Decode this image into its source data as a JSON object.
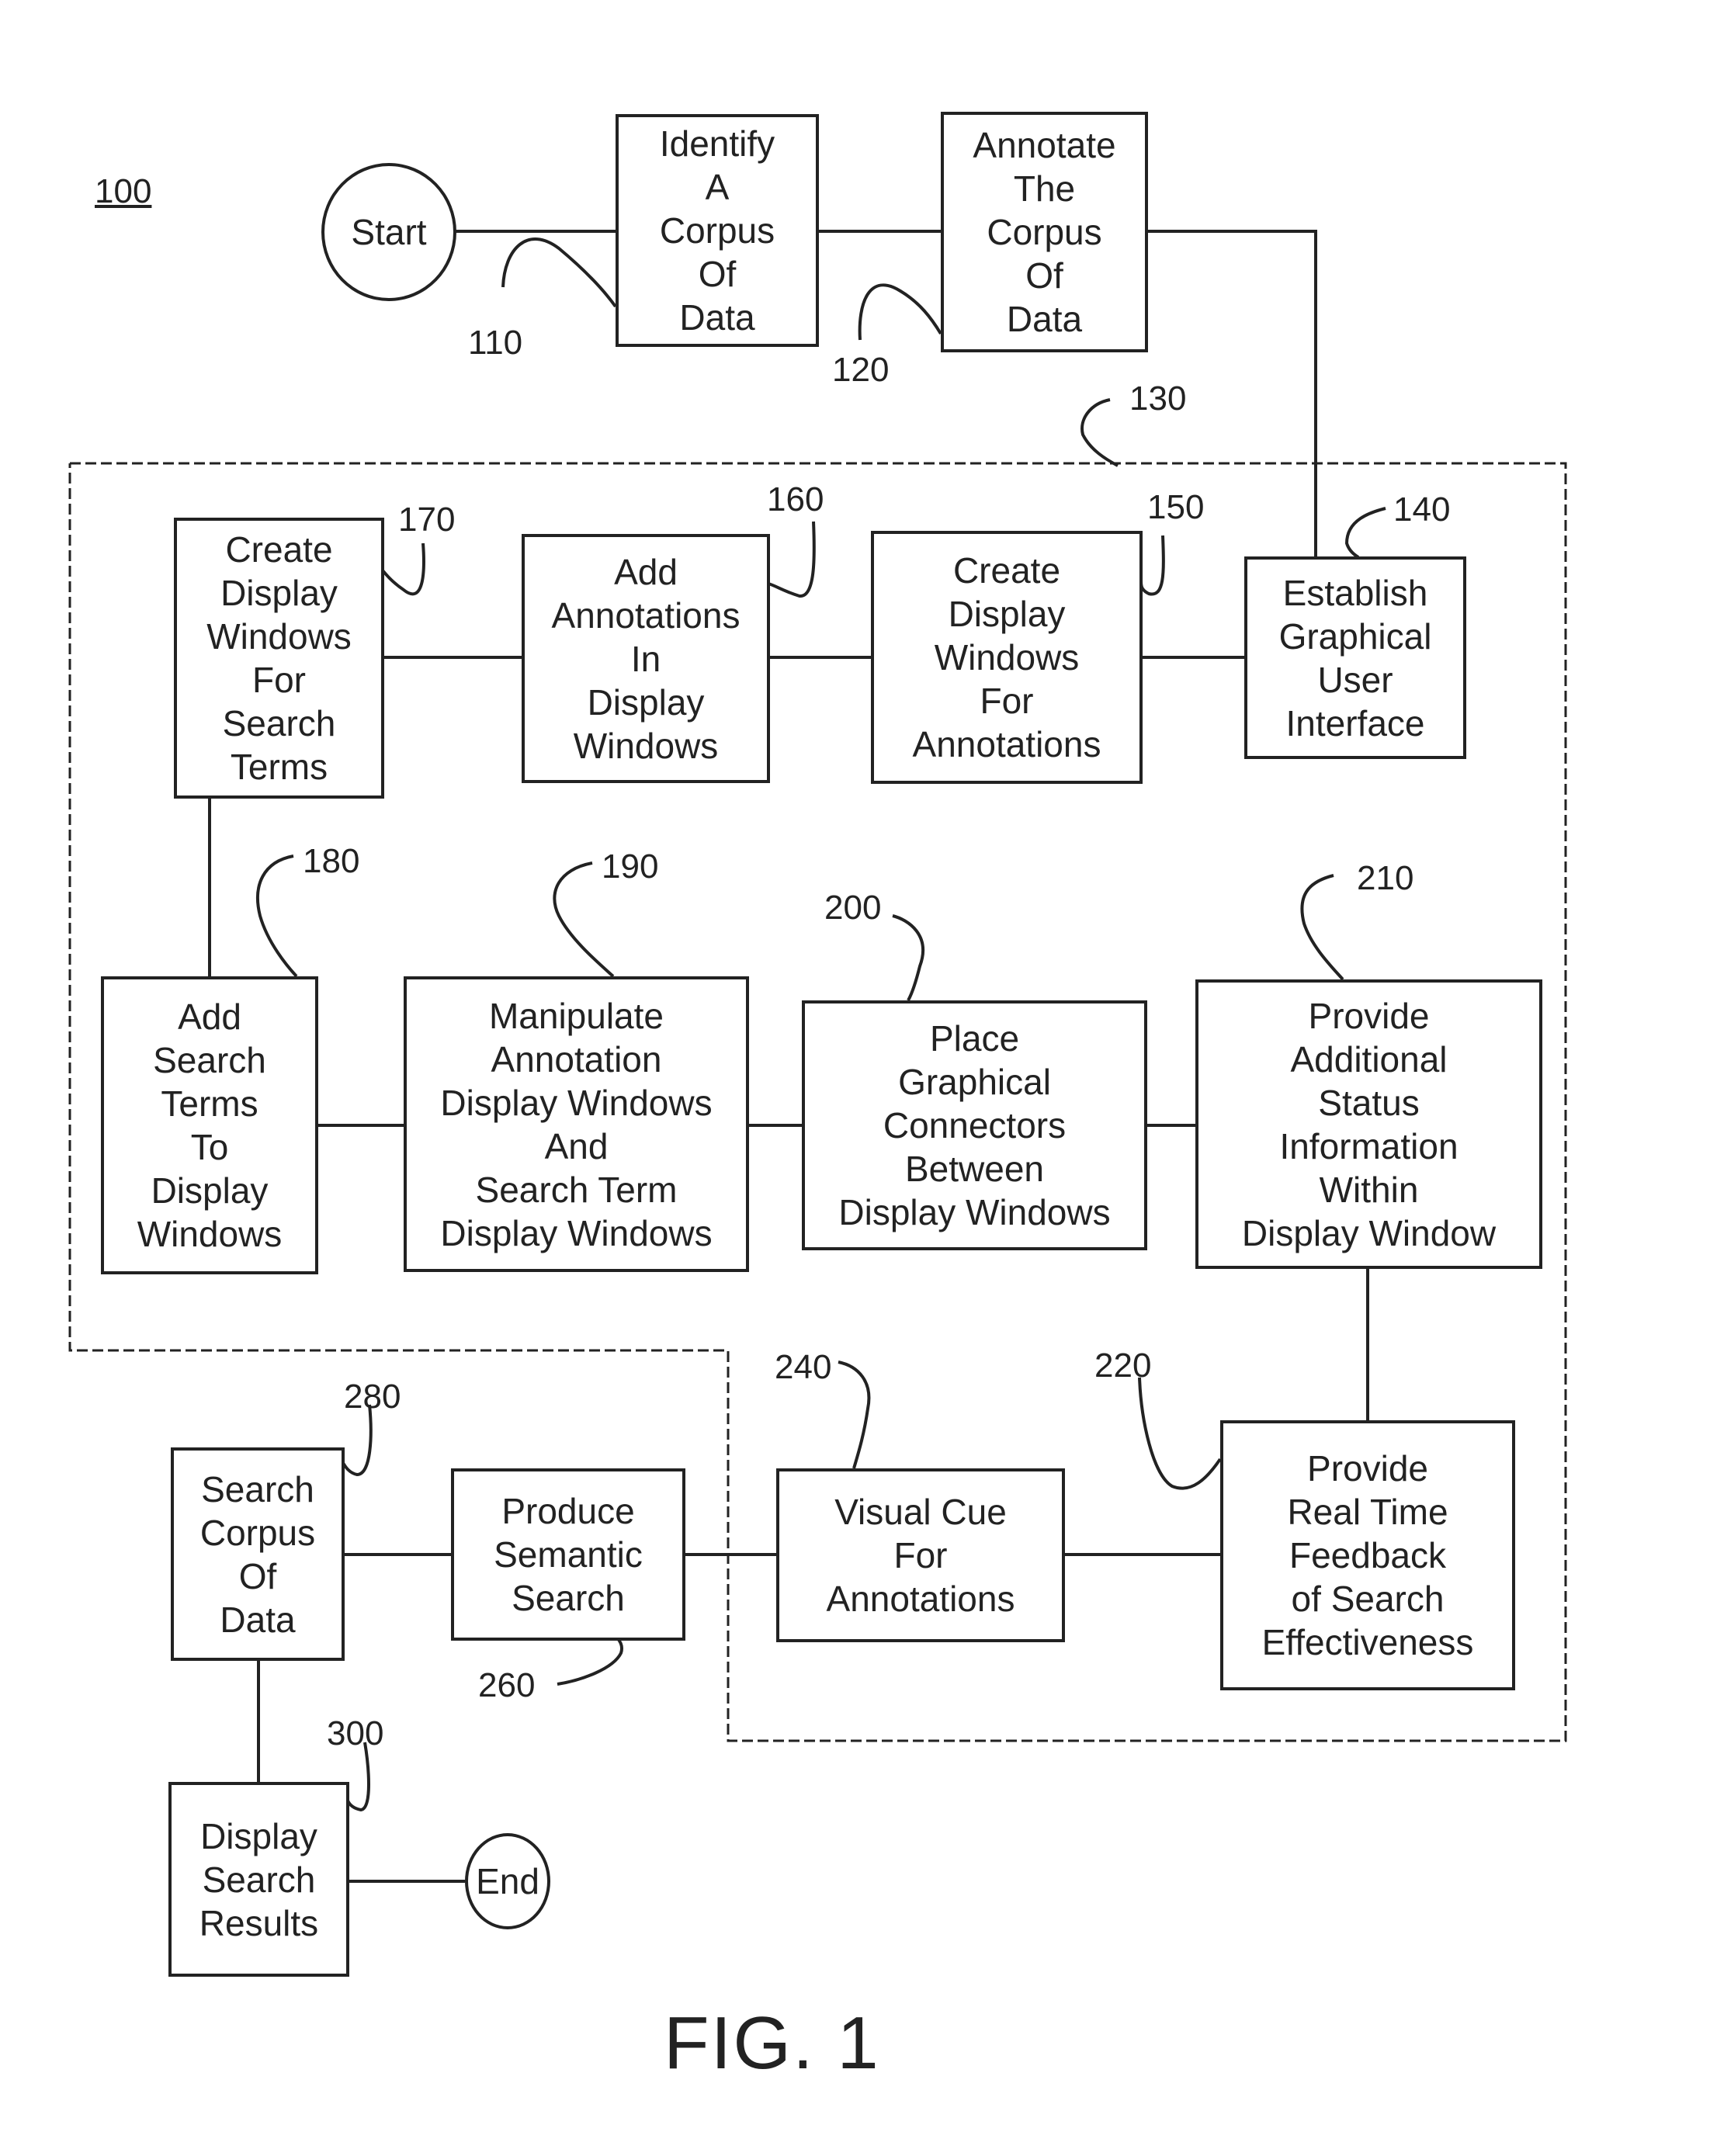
{
  "diagram_id": "100",
  "figure_label": "FIG. 1",
  "terminals": {
    "start": "Start",
    "end": "End"
  },
  "region": {
    "ref": "130"
  },
  "steps": {
    "s110": {
      "ref": "110",
      "lines": [
        "Identify",
        "A",
        "Corpus",
        "Of",
        "Data"
      ]
    },
    "s120": {
      "ref": "120",
      "lines": [
        "Annotate",
        "The",
        "Corpus",
        "Of",
        "Data"
      ]
    },
    "s140": {
      "ref": "140",
      "lines": [
        "Establish",
        "Graphical",
        "User",
        "Interface"
      ]
    },
    "s150": {
      "ref": "150",
      "lines": [
        "Create",
        "Display",
        "Windows",
        "For",
        "Annotations"
      ]
    },
    "s160": {
      "ref": "160",
      "lines": [
        "Add",
        "Annotations",
        "In",
        "Display",
        "Windows"
      ]
    },
    "s170": {
      "ref": "170",
      "lines": [
        "Create",
        "Display",
        "Windows",
        "For",
        "Search",
        "Terms"
      ]
    },
    "s180": {
      "ref": "180",
      "lines": [
        "Add",
        "Search",
        "Terms",
        "To",
        "Display",
        "Windows"
      ]
    },
    "s190": {
      "ref": "190",
      "lines": [
        "Manipulate",
        "Annotation",
        "Display Windows",
        "And",
        "Search Term",
        "Display Windows"
      ]
    },
    "s200": {
      "ref": "200",
      "lines": [
        "Place",
        "Graphical",
        "Connectors",
        "Between",
        "Display Windows"
      ]
    },
    "s210": {
      "ref": "210",
      "lines": [
        "Provide",
        "Additional",
        "Status",
        "Information",
        "Within",
        "Display Window"
      ]
    },
    "s220": {
      "ref": "220",
      "lines": [
        "Provide",
        "Real Time",
        "Feedback",
        "of Search",
        "Effectiveness"
      ]
    },
    "s240": {
      "ref": "240",
      "lines": [
        "Visual Cue",
        "For",
        "Annotations"
      ]
    },
    "s260": {
      "ref": "260",
      "lines": [
        "Produce",
        "Semantic",
        "Search"
      ]
    },
    "s280": {
      "ref": "280",
      "lines": [
        "Search",
        "Corpus",
        "Of",
        "Data"
      ]
    },
    "s300": {
      "ref": "300",
      "lines": [
        "Display",
        "Search",
        "Results"
      ]
    }
  },
  "flow": [
    "start",
    "s110",
    "s120",
    "s140",
    "s150",
    "s160",
    "s170",
    "s180",
    "s190",
    "s200",
    "s210",
    "s220",
    "s240",
    "s260",
    "s280",
    "s300",
    "end"
  ]
}
